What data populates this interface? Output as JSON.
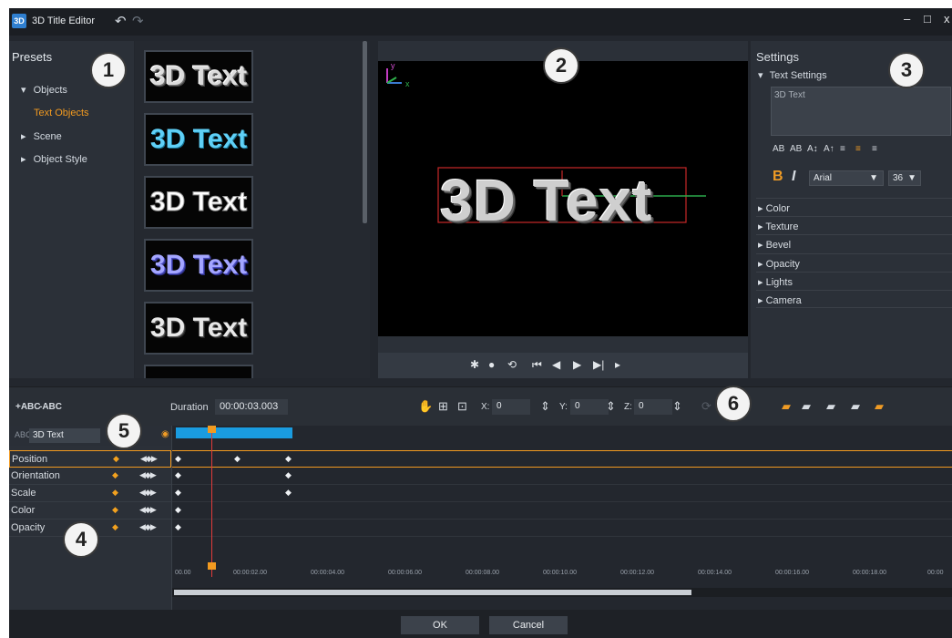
{
  "app": {
    "icon_label": "3D",
    "title": "3D Title Editor"
  },
  "toolbar": {
    "undo": "↶",
    "redo": "↷"
  },
  "window": {
    "minimize": "–",
    "maximize": "□",
    "close": "x"
  },
  "presets": {
    "title": "Presets",
    "tree": [
      {
        "label": "Objects",
        "arrow": "▾"
      },
      {
        "label": "Text Objects",
        "arrow": ""
      },
      {
        "label": "Scene",
        "arrow": "▸"
      },
      {
        "label": "Object Style",
        "arrow": "▸"
      }
    ],
    "thumbnails": [
      "3D Text",
      "3D Text",
      "3D Text",
      "3D Text",
      "3D Text"
    ]
  },
  "preview": {
    "axis_y": "y",
    "axis_x": "x",
    "text": "3D Text",
    "controls": [
      "✱",
      "●",
      "⟲",
      "⏮",
      "◀",
      "▶",
      "▶|",
      "▸"
    ]
  },
  "settings": {
    "title": "Settings",
    "text_settings_label": "Text Settings",
    "text_value": "3D Text",
    "format_buttons": [
      "AB",
      "AB",
      "A↕",
      "A↑",
      "≡",
      "≡",
      "≡"
    ],
    "bold": "B",
    "italic": "I",
    "font": "Arial",
    "size": "36",
    "sections": [
      "Color",
      "Texture",
      "Bevel",
      "Opacity",
      "Lights",
      "Camera"
    ]
  },
  "timeline_toolbar": {
    "add_text": "+ABC",
    "remove_text": "-ABC",
    "duration_label": "Duration",
    "duration_value": "00:00:03.003",
    "x_label": "X:",
    "x_value": "0",
    "y_label": "Y:",
    "y_value": "0",
    "z_label": "Z:",
    "z_value": "0"
  },
  "timeline": {
    "layer_label": "ABC",
    "layer_name": "3D Text",
    "properties": [
      "Position",
      "Orientation",
      "Scale",
      "Color",
      "Opacity"
    ],
    "ruler": [
      "00.00",
      "00:00:02.00",
      "00:00:04.00",
      "00:00:06.00",
      "00:00:08.00",
      "00:00:10.00",
      "00:00:12.00",
      "00:00:14.00",
      "00:00:16.00",
      "00:00:18.00",
      "00:00"
    ]
  },
  "footer": {
    "ok": "OK",
    "cancel": "Cancel"
  },
  "callouts": [
    "1",
    "2",
    "3",
    "4",
    "5",
    "6"
  ]
}
